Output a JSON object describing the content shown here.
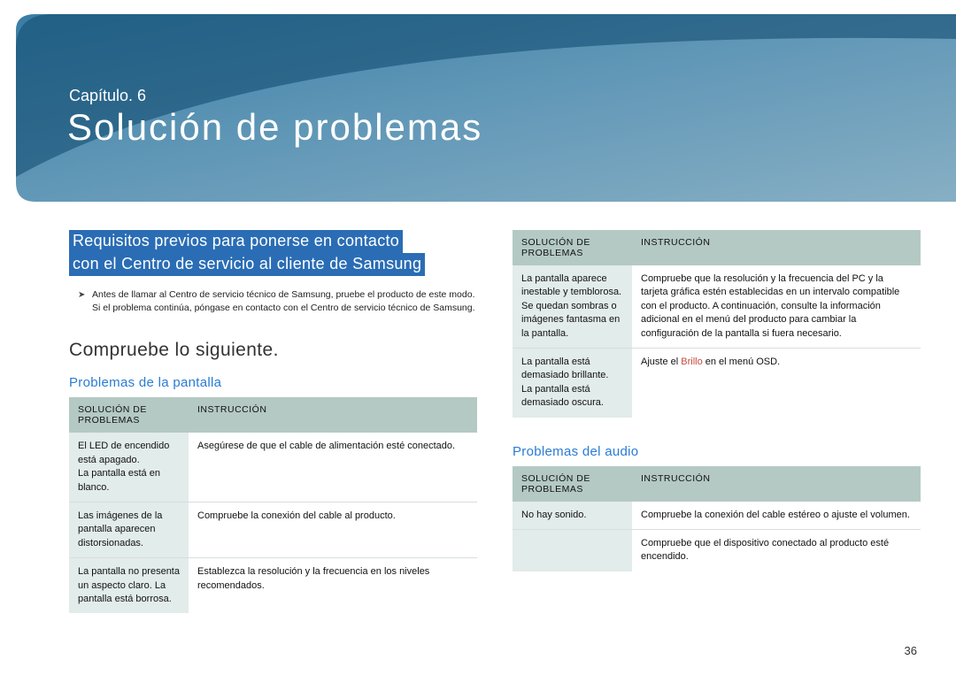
{
  "chapter_label": "Capítulo. 6",
  "chapter_title": "Solución de problemas",
  "highlight": {
    "line1": "Requisitos previos para ponerse en contacto",
    "line2": "con el Centro de servicio al cliente de Samsung"
  },
  "note_text": "Antes de llamar al Centro de servicio técnico de Samsung, pruebe el producto de este modo. Si el problema continúa, póngase en contacto con el Centro de servicio técnico de Samsung.",
  "section_heading": "Compruebe lo siguiente.",
  "sub1": "Problemas de la pantalla",
  "sub2": "Problemas del audio",
  "headers": {
    "problem": "SOLUCIÓN DE PROBLEMAS",
    "instruction": "INSTRUCCIÓN"
  },
  "table1": {
    "rows": [
      {
        "p": "El LED de encendido está apagado.\nLa pantalla está en blanco.",
        "i": "Asegúrese de que el cable de alimentación esté conectado."
      },
      {
        "p": "Las imágenes de la pantalla aparecen distorsionadas.",
        "i": "Compruebe la conexión del cable al producto."
      },
      {
        "p": "La pantalla no presenta un aspecto claro. La pantalla está borrosa.",
        "i": "Establezca la resolución y la frecuencia en los niveles recomendados."
      }
    ]
  },
  "table2": {
    "rows": [
      {
        "p": "La pantalla aparece inestable y temblorosa.\nSe quedan sombras o imágenes fantasma en la pantalla.",
        "i": "Compruebe que la resolución y la frecuencia del PC y la tarjeta gráfica estén establecidas en un intervalo compatible con el producto. A continuación, consulte la información adicional en el menú del producto para cambiar la configuración de la pantalla si fuera necesario."
      },
      {
        "p": "La pantalla está demasiado brillante.\nLa pantalla está demasiado oscura.",
        "i_pre": "Ajuste el ",
        "i_brillo": "Brillo",
        "i_post": " en el menú OSD."
      }
    ]
  },
  "table3": {
    "rows": [
      {
        "p": "No hay sonido.",
        "i": "Compruebe la conexión del cable estéreo o ajuste el volumen."
      },
      {
        "p": "",
        "i": "Compruebe que el dispositivo conectado al producto esté encendido."
      }
    ]
  },
  "page_number": "36"
}
